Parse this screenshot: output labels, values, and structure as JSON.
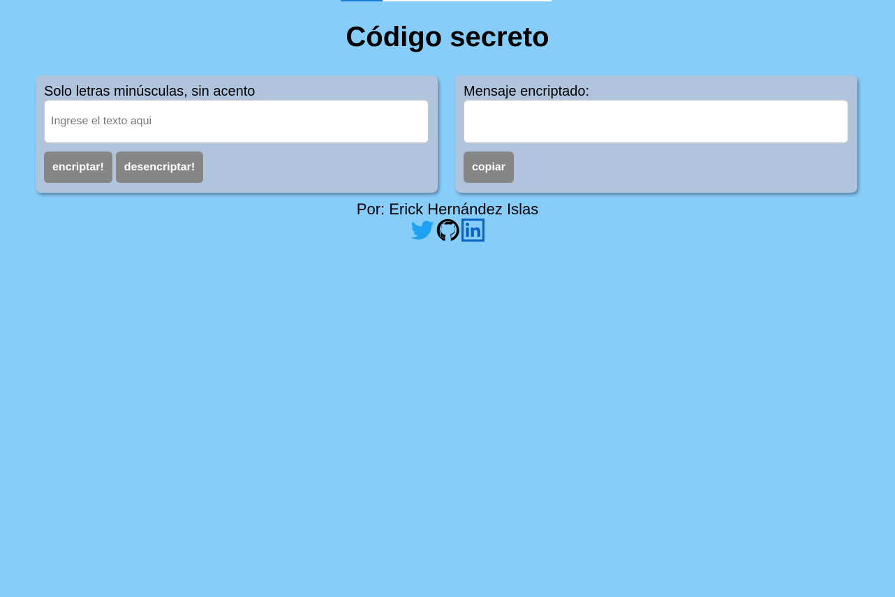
{
  "page": {
    "title": "Código secreto"
  },
  "encrypt_panel": {
    "label": "Solo letras minúsculas, sin acento",
    "input_value": "",
    "input_placeholder": "Ingrese el texto aqui",
    "encrypt_label": "encriptar!",
    "decrypt_label": "desencriptar!"
  },
  "result_panel": {
    "label": "Mensaje encriptado:",
    "output_value": "",
    "copy_label": "copiar"
  },
  "footer": {
    "author": "Por: Erick Hernández Islas",
    "links": [
      {
        "icon": "twitter-icon",
        "color": "#1DA1F2"
      },
      {
        "icon": "github-icon",
        "color": "#000000"
      },
      {
        "icon": "linkedin-icon",
        "color": "#0A66C2"
      }
    ]
  },
  "colors": {
    "background": "#87CDF9",
    "panel": "#B0C4DE",
    "button": "#868686",
    "progress_fill": "#1a7fd4"
  },
  "top_progress": {
    "fraction": 0.2
  }
}
